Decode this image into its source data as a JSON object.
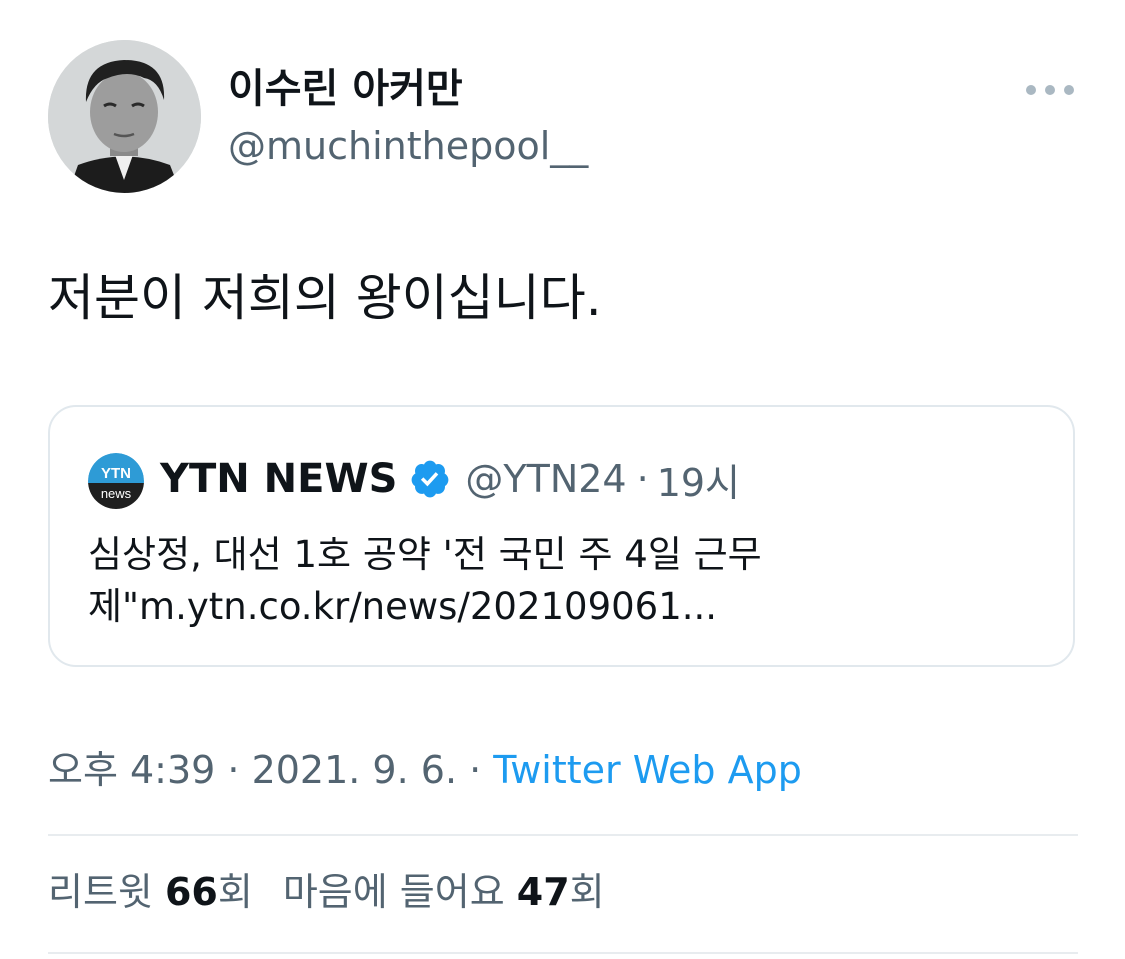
{
  "author": {
    "display_name": "이수린 아커만",
    "handle": "@muchinthepool__"
  },
  "tweet": {
    "text": "저분이 저희의 왕이십니다."
  },
  "quoted_tweet": {
    "logo_text_top": "YTN",
    "logo_text_bottom": "news",
    "name": "YTN NEWS",
    "verified": true,
    "handle": "@YTN24",
    "separator": "·",
    "time": "19시",
    "body_line_1": "심상정, 대선 1호 공약 '전 국민 주 4일 근무",
    "body_line_2": "제\"m.ytn.co.kr/news/202109061..."
  },
  "meta": {
    "timestamp": "오후 4:39 · 2021. 9. 6. · ",
    "source": "Twitter Web App"
  },
  "stats": {
    "retweet_label": "리트윗 ",
    "retweet_count": "66",
    "retweet_unit": "회",
    "like_label": "마음에 들어요 ",
    "like_count": "47",
    "like_unit": "회"
  },
  "icons": {
    "more": "more-horizontal-icon",
    "verified": "verified-badge-icon"
  },
  "colors": {
    "link": "#1d9bf0",
    "secondary_text": "#536471",
    "primary_text": "#0f1419",
    "border": "#e1e8ed"
  }
}
